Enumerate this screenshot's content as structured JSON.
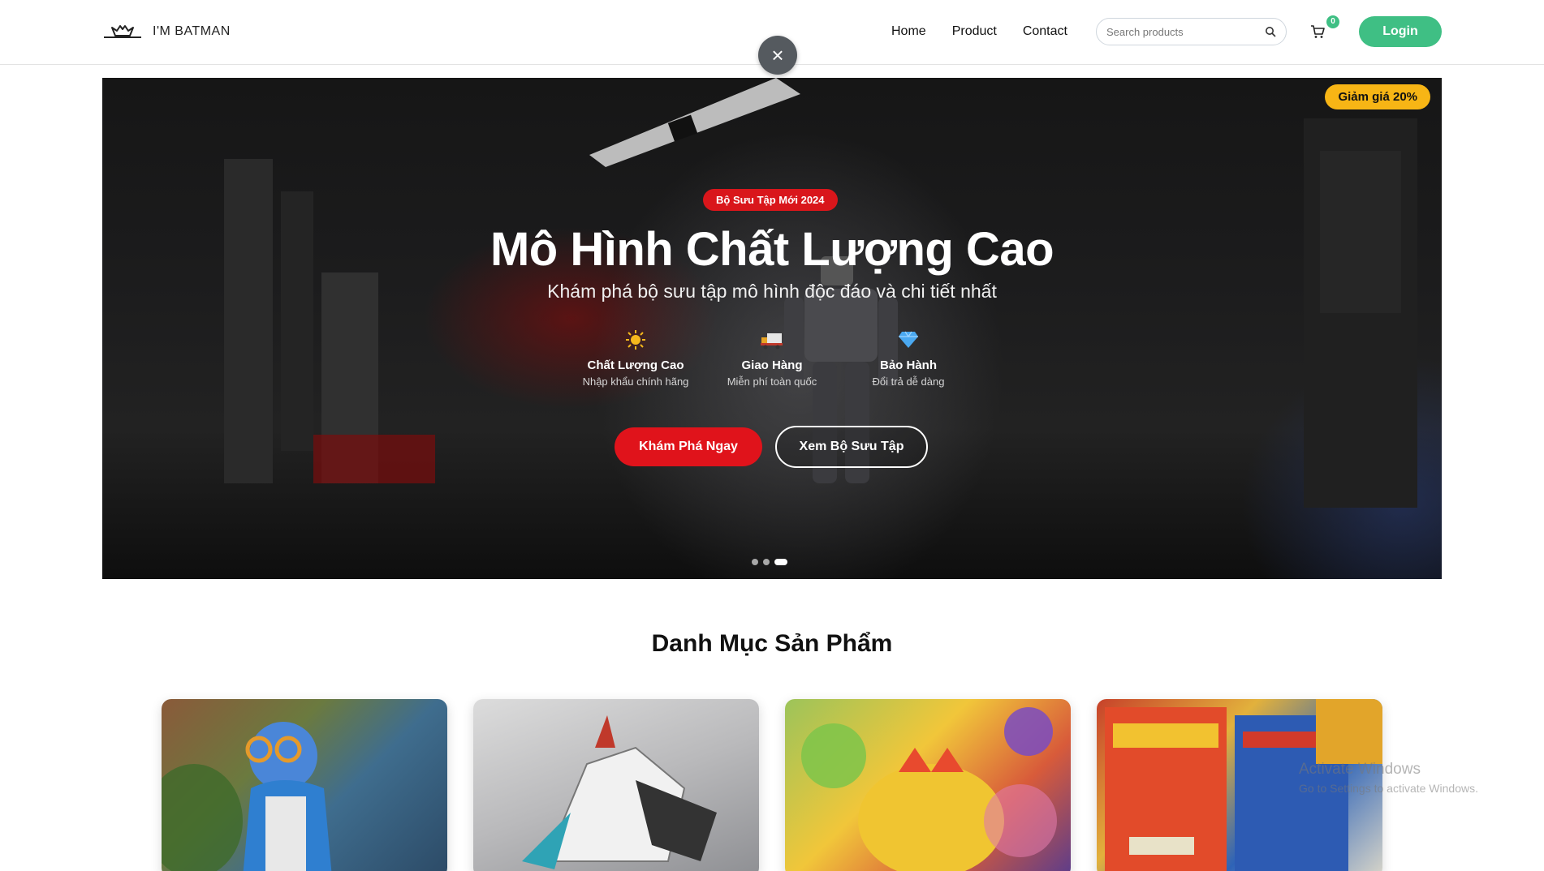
{
  "brand": {
    "name": "I'M BATMAN",
    "icon": "bat-logo-icon"
  },
  "nav": {
    "items": [
      {
        "label": "Home"
      },
      {
        "label": "Product"
      },
      {
        "label": "Contact"
      }
    ]
  },
  "search": {
    "placeholder": "Search products",
    "icon": "search-icon"
  },
  "cart": {
    "icon": "cart-icon",
    "count": "0"
  },
  "login": {
    "label": "Login"
  },
  "overlay": {
    "close_icon": "close-icon",
    "close_glyph": "×"
  },
  "hero": {
    "discount_badge": "Giảm giá 20%",
    "collection_pill": "Bộ Sưu Tập Mới 2024",
    "title": "Mô Hình Chất Lượng Cao",
    "subtitle": "Khám phá bộ sưu tập mô hình độc đáo và chi tiết nhất",
    "features": [
      {
        "icon": "sun-icon",
        "title": "Chất Lượng Cao",
        "desc": "Nhập khẩu chính hãng"
      },
      {
        "icon": "delivery-truck-icon",
        "title": "Giao Hàng",
        "desc": "Miễn phí toàn quốc"
      },
      {
        "icon": "diamond-icon",
        "title": "Bảo Hành",
        "desc": "Đổi trả dễ dàng"
      }
    ],
    "primary_button": "Khám Phá Ngay",
    "secondary_button": "Xem Bộ Sưu Tập",
    "slides": {
      "count": 3,
      "active_index": 2
    }
  },
  "categories": {
    "title": "Danh Mục Sản Phẩm",
    "cards": [
      {
        "image": "anime-figure-photo"
      },
      {
        "image": "mecha-model-photo"
      },
      {
        "image": "toy-figures-photo"
      },
      {
        "image": "comic-books-photo"
      }
    ]
  },
  "windows_watermark": {
    "line1": "Activate Windows",
    "line2": "Go to Settings to activate Windows."
  },
  "colors": {
    "accent_green": "#3fbf84",
    "accent_red": "#e0131b",
    "badge_yellow": "#f7b515"
  }
}
